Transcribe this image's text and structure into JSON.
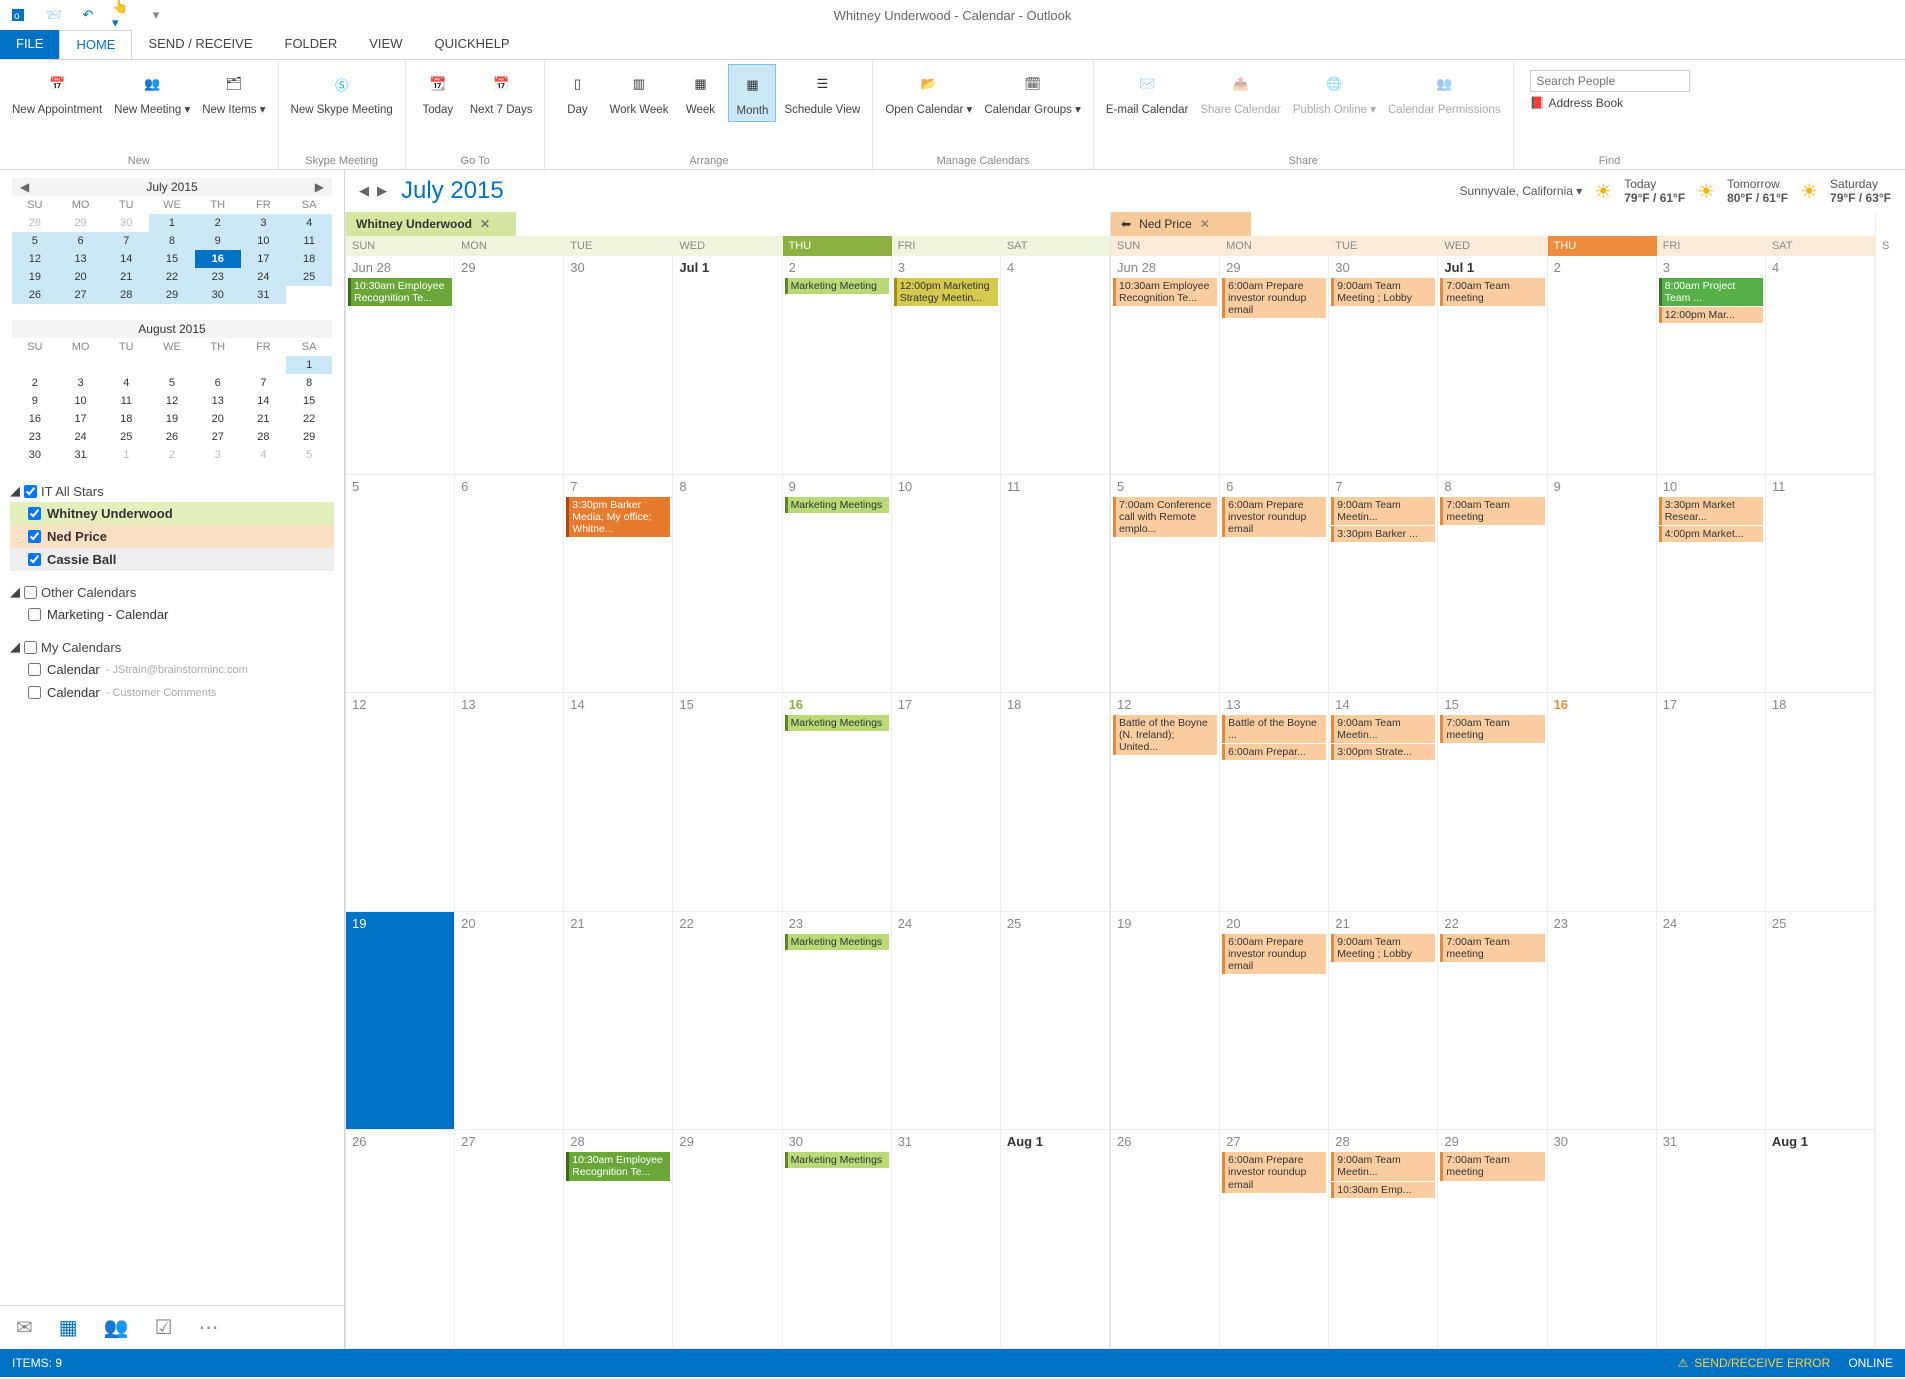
{
  "window": {
    "title": "Whitney Underwood - Calendar - Outlook"
  },
  "tabs": {
    "file": "FILE",
    "home": "HOME",
    "sendrecv": "SEND / RECEIVE",
    "folder": "FOLDER",
    "view": "VIEW",
    "quickhelp": "QUICKHELP"
  },
  "ribbon": {
    "new": {
      "appointment": "New Appointment",
      "meeting": "New Meeting",
      "items": "New Items",
      "title": "New"
    },
    "skype": {
      "btn": "New Skype Meeting",
      "title": "Skype Meeting"
    },
    "goto": {
      "today": "Today",
      "next7": "Next 7 Days",
      "title": "Go To"
    },
    "arrange": {
      "day": "Day",
      "workweek": "Work Week",
      "week": "Week",
      "month": "Month",
      "schedule": "Schedule View",
      "title": "Arrange"
    },
    "manage": {
      "open": "Open Calendar",
      "groups": "Calendar Groups",
      "title": "Manage Calendars"
    },
    "share": {
      "email": "E-mail Calendar",
      "share": "Share Calendar",
      "publish": "Publish Online",
      "perms": "Calendar Permissions",
      "title": "Share"
    },
    "find": {
      "search_placeholder": "Search People",
      "addressbook": "Address Book",
      "title": "Find"
    }
  },
  "minical1": {
    "title": "July 2015",
    "dh": [
      "SU",
      "MO",
      "TU",
      "WE",
      "TH",
      "FR",
      "SA"
    ],
    "rows": [
      [
        {
          "n": 28,
          "o": true
        },
        {
          "n": 29,
          "o": true
        },
        {
          "n": 30,
          "o": true
        },
        {
          "n": 1
        },
        {
          "n": 2
        },
        {
          "n": 3
        },
        {
          "n": 4
        }
      ],
      [
        {
          "n": 5
        },
        {
          "n": 6
        },
        {
          "n": 7
        },
        {
          "n": 8
        },
        {
          "n": 9
        },
        {
          "n": 10
        },
        {
          "n": 11
        }
      ],
      [
        {
          "n": 12
        },
        {
          "n": 13
        },
        {
          "n": 14
        },
        {
          "n": 15
        },
        {
          "n": 16,
          "today": true
        },
        {
          "n": 17
        },
        {
          "n": 18
        }
      ],
      [
        {
          "n": 19
        },
        {
          "n": 20
        },
        {
          "n": 21
        },
        {
          "n": 22
        },
        {
          "n": 23
        },
        {
          "n": 24
        },
        {
          "n": 25
        }
      ],
      [
        {
          "n": 26
        },
        {
          "n": 27
        },
        {
          "n": 28
        },
        {
          "n": 29
        },
        {
          "n": 30
        },
        {
          "n": 31
        },
        {
          "n": ""
        }
      ]
    ]
  },
  "minical2": {
    "title": "August 2015",
    "dh": [
      "SU",
      "MO",
      "TU",
      "WE",
      "TH",
      "FR",
      "SA"
    ],
    "rows": [
      [
        {
          "n": ""
        },
        {
          "n": ""
        },
        {
          "n": ""
        },
        {
          "n": ""
        },
        {
          "n": ""
        },
        {
          "n": ""
        },
        {
          "n": 1,
          "cur": true
        }
      ],
      [
        {
          "n": 2
        },
        {
          "n": 3
        },
        {
          "n": 4
        },
        {
          "n": 5
        },
        {
          "n": 6
        },
        {
          "n": 7
        },
        {
          "n": 8
        }
      ],
      [
        {
          "n": 9
        },
        {
          "n": 10
        },
        {
          "n": 11
        },
        {
          "n": 12
        },
        {
          "n": 13
        },
        {
          "n": 14
        },
        {
          "n": 15
        }
      ],
      [
        {
          "n": 16
        },
        {
          "n": 17
        },
        {
          "n": 18
        },
        {
          "n": 19
        },
        {
          "n": 20
        },
        {
          "n": 21
        },
        {
          "n": 22
        }
      ],
      [
        {
          "n": 23
        },
        {
          "n": 24
        },
        {
          "n": 25
        },
        {
          "n": 26
        },
        {
          "n": 27
        },
        {
          "n": 28
        },
        {
          "n": 29
        }
      ],
      [
        {
          "n": 30
        },
        {
          "n": 31
        },
        {
          "n": 1,
          "o": true
        },
        {
          "n": 2,
          "o": true
        },
        {
          "n": 3,
          "o": true
        },
        {
          "n": 4,
          "o": true
        },
        {
          "n": 5,
          "o": true
        }
      ]
    ]
  },
  "callist": {
    "group1": {
      "name": "IT All Stars",
      "items": [
        "Whitney Underwood",
        "Ned Price",
        "Cassie Ball"
      ]
    },
    "group2": {
      "name": "Other Calendars",
      "items": [
        "Marketing - Calendar"
      ]
    },
    "group3": {
      "name": "My Calendars",
      "items": [
        {
          "label": "Calendar",
          "sub": "- JStrain@brainstorminc.com"
        },
        {
          "label": "Calendar",
          "sub": "- Customer Comments"
        }
      ]
    }
  },
  "calheader": {
    "title": "July 2015",
    "location": "Sunnyvale, California",
    "weather": [
      {
        "label": "Today",
        "temp": "79°F / 61°F"
      },
      {
        "label": "Tomorrow",
        "temp": "80°F / 61°F"
      },
      {
        "label": "Saturday",
        "temp": "79°F / 63°F"
      }
    ]
  },
  "caltabs": {
    "whitney": "Whitney Underwood",
    "ned": "Ned Price"
  },
  "dayheaders": [
    "SUN",
    "MON",
    "TUE",
    "WED",
    "THU",
    "FRI",
    "SAT"
  ],
  "whitney_cells": [
    [
      {
        "dn": "Jun 28",
        "evts": [
          {
            "c": "green-d",
            "t": "10:30am Employee Recognition Te..."
          }
        ]
      },
      {
        "dn": "29"
      },
      {
        "dn": "30"
      },
      {
        "dn": "Jul 1",
        "bold": true
      },
      {
        "dn": "2",
        "evts": [
          {
            "c": "green",
            "t": "Marketing Meeting"
          }
        ]
      },
      {
        "dn": "3",
        "evts": [
          {
            "c": "olive",
            "t": "12:00pm Marketing Strategy Meetin..."
          }
        ]
      },
      {
        "dn": "4"
      }
    ],
    [
      {
        "dn": "5"
      },
      {
        "dn": "6"
      },
      {
        "dn": "7",
        "evts": [
          {
            "c": "orange-d",
            "t": "3:30pm Barker Media; My office; Whitne..."
          }
        ]
      },
      {
        "dn": "8"
      },
      {
        "dn": "9",
        "evts": [
          {
            "c": "green",
            "t": "Marketing Meetings"
          }
        ]
      },
      {
        "dn": "10"
      },
      {
        "dn": "11"
      }
    ],
    [
      {
        "dn": "12"
      },
      {
        "dn": "13"
      },
      {
        "dn": "14"
      },
      {
        "dn": "15"
      },
      {
        "dn": "16",
        "today": true,
        "evts": [
          {
            "c": "green",
            "t": "Marketing Meetings"
          }
        ]
      },
      {
        "dn": "17"
      },
      {
        "dn": "18"
      }
    ],
    [
      {
        "dn": "19",
        "sel": true
      },
      {
        "dn": "20"
      },
      {
        "dn": "21"
      },
      {
        "dn": "22"
      },
      {
        "dn": "23",
        "evts": [
          {
            "c": "green",
            "t": "Marketing Meetings"
          }
        ]
      },
      {
        "dn": "24"
      },
      {
        "dn": "25"
      }
    ],
    [
      {
        "dn": "26"
      },
      {
        "dn": "27"
      },
      {
        "dn": "28",
        "evts": [
          {
            "c": "green-d",
            "t": "10:30am Employee Recognition Te..."
          }
        ]
      },
      {
        "dn": "29"
      },
      {
        "dn": "30",
        "evts": [
          {
            "c": "green",
            "t": "Marketing Meetings"
          }
        ]
      },
      {
        "dn": "31"
      },
      {
        "dn": "Aug 1",
        "bold": true
      }
    ]
  ],
  "ned_cells": [
    [
      {
        "dn": "Jun 28",
        "evts": [
          {
            "c": "orange",
            "t": "10:30am Employee Recognition Te..."
          }
        ]
      },
      {
        "dn": "29",
        "evts": [
          {
            "c": "orange",
            "t": "6:00am Prepare investor roundup email"
          }
        ]
      },
      {
        "dn": "30",
        "evts": [
          {
            "c": "orange",
            "t": "9:00am Team Meeting ; Lobby"
          }
        ]
      },
      {
        "dn": "Jul 1",
        "bold": true,
        "evts": [
          {
            "c": "orange",
            "t": "7:00am Team meeting"
          }
        ]
      },
      {
        "dn": "2"
      },
      {
        "dn": "3",
        "evts": [
          {
            "c": "green2",
            "t": "8:00am Project Team ..."
          },
          {
            "c": "orange",
            "t": "12:00pm Mar..."
          }
        ]
      },
      {
        "dn": "4"
      }
    ],
    [
      {
        "dn": "5",
        "evts": [
          {
            "c": "orange",
            "t": "7:00am Conference call with Remote emplo..."
          }
        ]
      },
      {
        "dn": "6",
        "evts": [
          {
            "c": "orange",
            "t": "6:00am Prepare investor roundup email"
          }
        ]
      },
      {
        "dn": "7",
        "evts": [
          {
            "c": "orange",
            "t": "9:00am Team Meetin..."
          },
          {
            "c": "orange",
            "t": "3:30pm Barker ..."
          }
        ]
      },
      {
        "dn": "8",
        "evts": [
          {
            "c": "orange",
            "t": "7:00am Team meeting"
          }
        ]
      },
      {
        "dn": "9"
      },
      {
        "dn": "10",
        "evts": [
          {
            "c": "orange",
            "t": "3:30pm Market Resear..."
          },
          {
            "c": "orange",
            "t": "4:00pm Market..."
          }
        ]
      },
      {
        "dn": "11"
      }
    ],
    [
      {
        "dn": "12",
        "evts": [
          {
            "c": "orange",
            "t": "Battle of the Boyne (N. Ireland); United..."
          }
        ]
      },
      {
        "dn": "13",
        "evts": [
          {
            "c": "orange",
            "t": "Battle of the Boyne ..."
          },
          {
            "c": "orange",
            "t": "6:00am Prepar..."
          }
        ]
      },
      {
        "dn": "14",
        "evts": [
          {
            "c": "orange",
            "t": "9:00am Team Meetin..."
          },
          {
            "c": "orange",
            "t": "3:00pm Strate..."
          }
        ]
      },
      {
        "dn": "15",
        "evts": [
          {
            "c": "orange",
            "t": "7:00am Team meeting"
          }
        ]
      },
      {
        "dn": "16",
        "today": true
      },
      {
        "dn": "17"
      },
      {
        "dn": "18"
      }
    ],
    [
      {
        "dn": "19"
      },
      {
        "dn": "20",
        "evts": [
          {
            "c": "orange",
            "t": "6:00am Prepare investor roundup email"
          }
        ]
      },
      {
        "dn": "21",
        "evts": [
          {
            "c": "orange",
            "t": "9:00am Team Meeting ; Lobby"
          }
        ]
      },
      {
        "dn": "22",
        "evts": [
          {
            "c": "orange",
            "t": "7:00am Team meeting"
          }
        ]
      },
      {
        "dn": "23"
      },
      {
        "dn": "24"
      },
      {
        "dn": "25"
      }
    ],
    [
      {
        "dn": "26"
      },
      {
        "dn": "27",
        "evts": [
          {
            "c": "orange",
            "t": "6:00am Prepare investor roundup email"
          }
        ]
      },
      {
        "dn": "28",
        "evts": [
          {
            "c": "orange",
            "t": "9:00am Team Meetin..."
          },
          {
            "c": "orange",
            "t": "10:30am Emp..."
          }
        ]
      },
      {
        "dn": "29",
        "evts": [
          {
            "c": "orange",
            "t": "7:00am Team meeting"
          }
        ]
      },
      {
        "dn": "30"
      },
      {
        "dn": "31"
      },
      {
        "dn": "Aug 1",
        "bold": true
      }
    ]
  ],
  "statusbar": {
    "items": "ITEMS: 9",
    "error": "SEND/RECEIVE ERROR",
    "online": "ONLINE"
  }
}
